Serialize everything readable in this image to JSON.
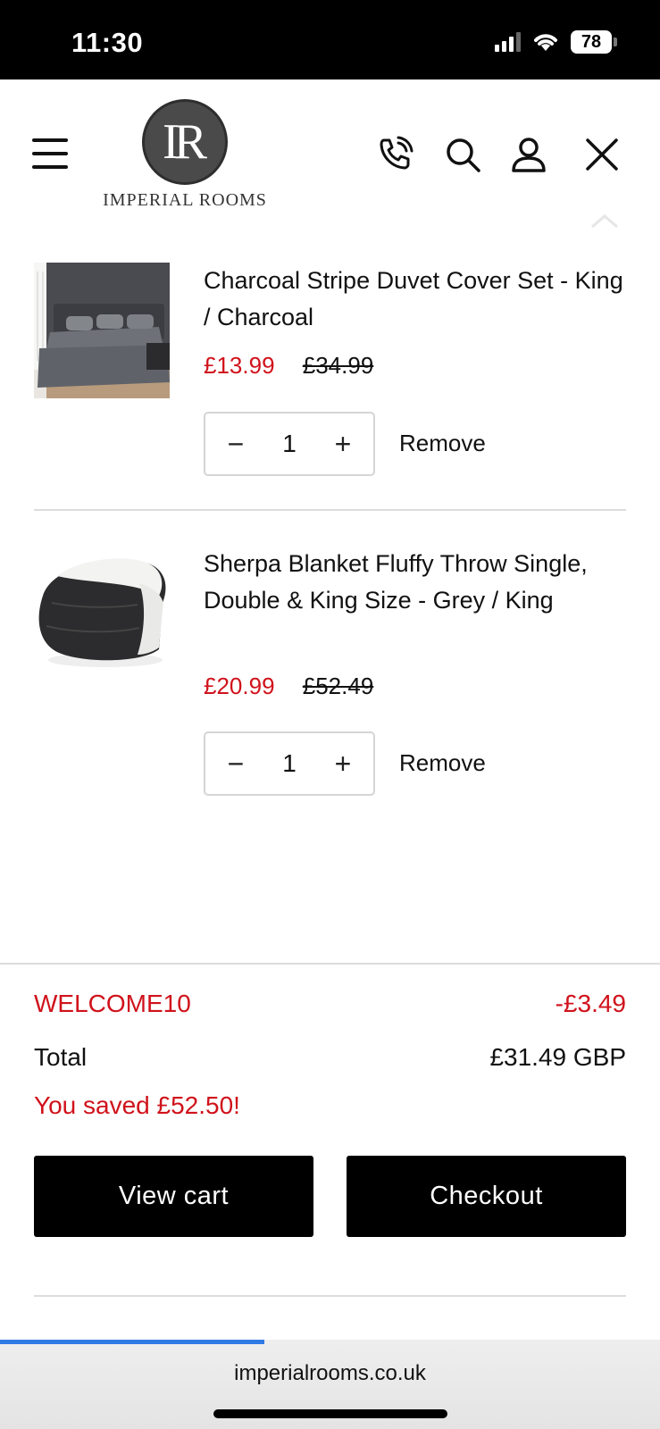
{
  "status_bar": {
    "time": "11:30",
    "battery": "78"
  },
  "header": {
    "logo_monogram": "IR",
    "logo_text": "IMPERIAL ROOMS",
    "icons": [
      "menu-icon",
      "phone-icon",
      "search-icon",
      "account-icon",
      "close-icon"
    ]
  },
  "cart": {
    "items": [
      {
        "title": "Charcoal Stripe Duvet Cover Set - King / Charcoal",
        "price": "£13.99",
        "compare_price": "£34.99",
        "quantity": "1",
        "remove_label": "Remove"
      },
      {
        "title": "Sherpa Blanket Fluffy Throw Single, Double & King Size - Grey / King",
        "price": "£20.99",
        "compare_price": "£52.49",
        "quantity": "1",
        "remove_label": "Remove"
      }
    ],
    "qty_minus": "−",
    "qty_plus": "+"
  },
  "summary": {
    "discount_code": "WELCOME10",
    "discount_amount": "-£3.49",
    "total_label": "Total",
    "total_value": "£31.49 GBP",
    "savings": "You saved £52.50!",
    "view_cart_label": "View cart",
    "checkout_label": "Checkout"
  },
  "browser": {
    "url": "imperialrooms.co.uk",
    "load_progress": 0.4
  },
  "colors": {
    "sale": "#d0121b",
    "button": "#000000",
    "progress": "#2f7be5"
  }
}
